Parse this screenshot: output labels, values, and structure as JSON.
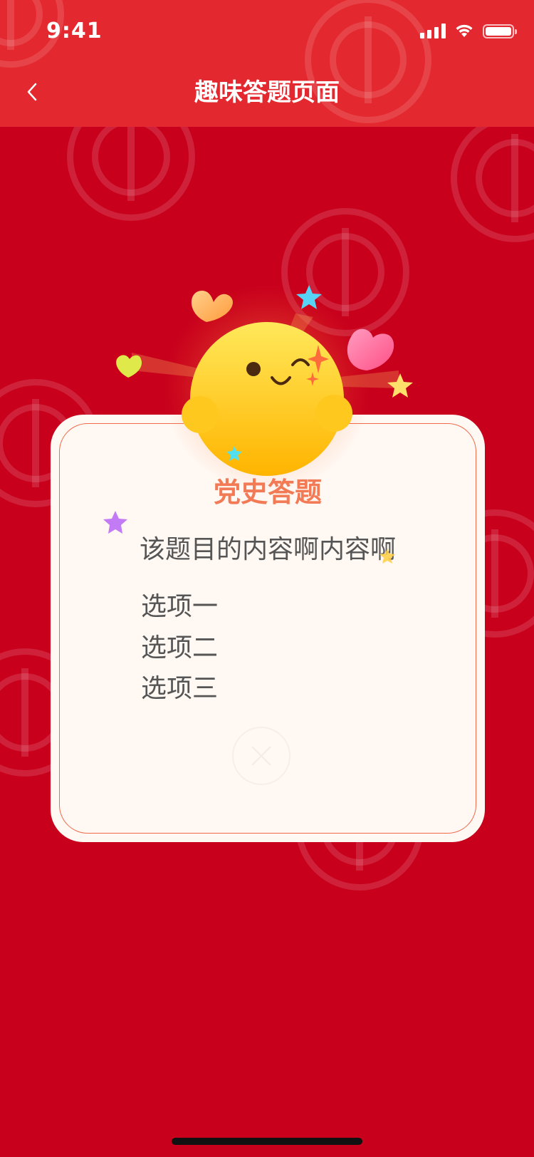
{
  "status_bar": {
    "time": "9:41"
  },
  "nav": {
    "title": "趣味答题页面"
  },
  "card": {
    "title": "党史答题",
    "question": "该题目的内容啊内容啊",
    "options": [
      "选项一",
      "选项二",
      "选项三"
    ]
  },
  "colors": {
    "background": "#c8001c",
    "header": "#e3292f",
    "card_bg": "#fff8f3",
    "card_title": "#f27a55",
    "text": "#555555",
    "mascot": "#ffc21a"
  },
  "icons": {
    "back": "chevron-left-icon",
    "close": "close-icon",
    "signal": "cellular-signal-icon",
    "wifi": "wifi-icon",
    "battery": "battery-icon"
  }
}
